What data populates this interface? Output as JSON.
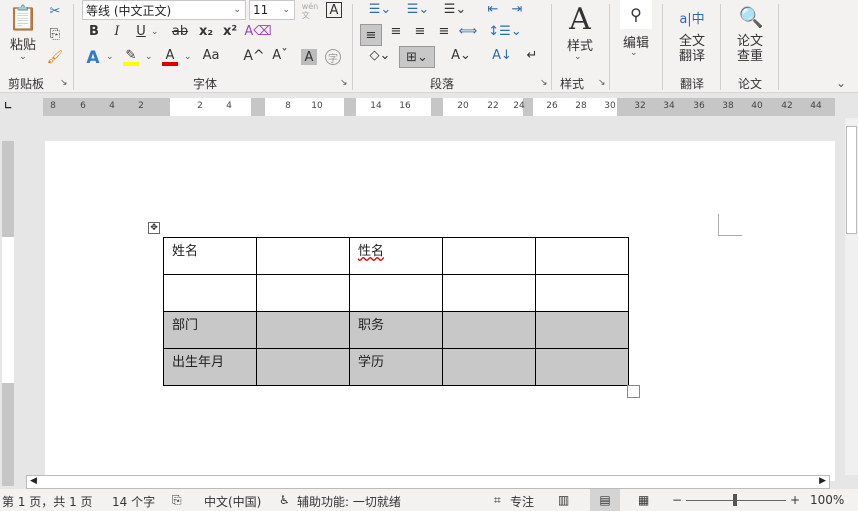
{
  "clipboard": {
    "paste": "粘贴",
    "label": "剪贴板"
  },
  "font": {
    "name": "等线 (中文正文)",
    "size": "11",
    "label": "字体",
    "phonetic": "wén\n文",
    "bold": "B",
    "italic": "I",
    "underline": "U",
    "strike": "ab",
    "sub": "x₂",
    "sup": "x²",
    "grow": "A^",
    "shrink": "Aˇ",
    "case": "Aa",
    "shade": "A",
    "enclose": "字",
    "border": "A",
    "effect": "A",
    "color": "A"
  },
  "paragraph": {
    "label": "段落"
  },
  "styles": {
    "btn": "样式",
    "label": "样式"
  },
  "editing": {
    "btn": "编辑"
  },
  "translate": {
    "btn": "全文\n翻译",
    "label": "翻译"
  },
  "paper": {
    "btn": "论文\n查重",
    "label": "论文"
  },
  "ruler": {
    "left": [
      "8",
      "6",
      "4",
      "2"
    ],
    "mid": [
      "2",
      "4",
      "8",
      "10",
      "14",
      "16",
      "20",
      "22",
      "24",
      "26",
      "28",
      "30"
    ],
    "right": [
      "32",
      "34",
      "36",
      "38",
      "40",
      "42",
      "44"
    ]
  },
  "table": [
    [
      "姓名",
      "",
      "性名",
      "",
      ""
    ],
    [
      "",
      "",
      "",
      "",
      ""
    ],
    [
      "部门",
      "",
      "职务",
      "",
      ""
    ],
    [
      "出生年月",
      "",
      "学历",
      "",
      ""
    ]
  ],
  "status": {
    "page": "第 1 页，共 1 页",
    "words": "14 个字",
    "lang": "中文(中国)",
    "access": "辅助功能: 一切就绪",
    "focus": "专注",
    "zoom": "100%"
  },
  "colors": {
    "highlight": "#ffff00",
    "font_color": "#e00000",
    "shade": "#c8c8c8"
  }
}
